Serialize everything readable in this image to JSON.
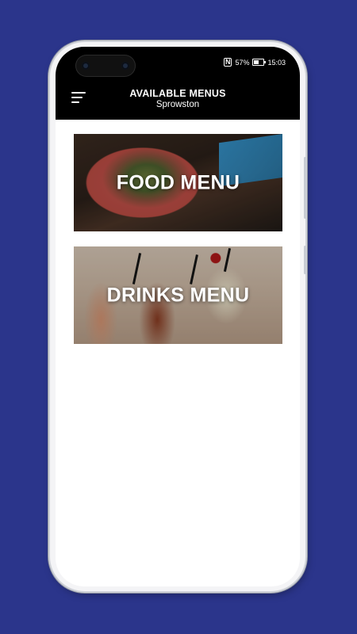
{
  "status_bar": {
    "nfc": "N",
    "battery": "57%",
    "time": "15:03"
  },
  "header": {
    "title": "AVAILABLE MENUS",
    "subtitle": "Sprowston"
  },
  "menus": [
    {
      "label": "FOOD MENU"
    },
    {
      "label": "DRINKS MENU"
    }
  ],
  "colors": {
    "background": "#2b358b",
    "header": "#000000",
    "screen": "#ffffff"
  }
}
